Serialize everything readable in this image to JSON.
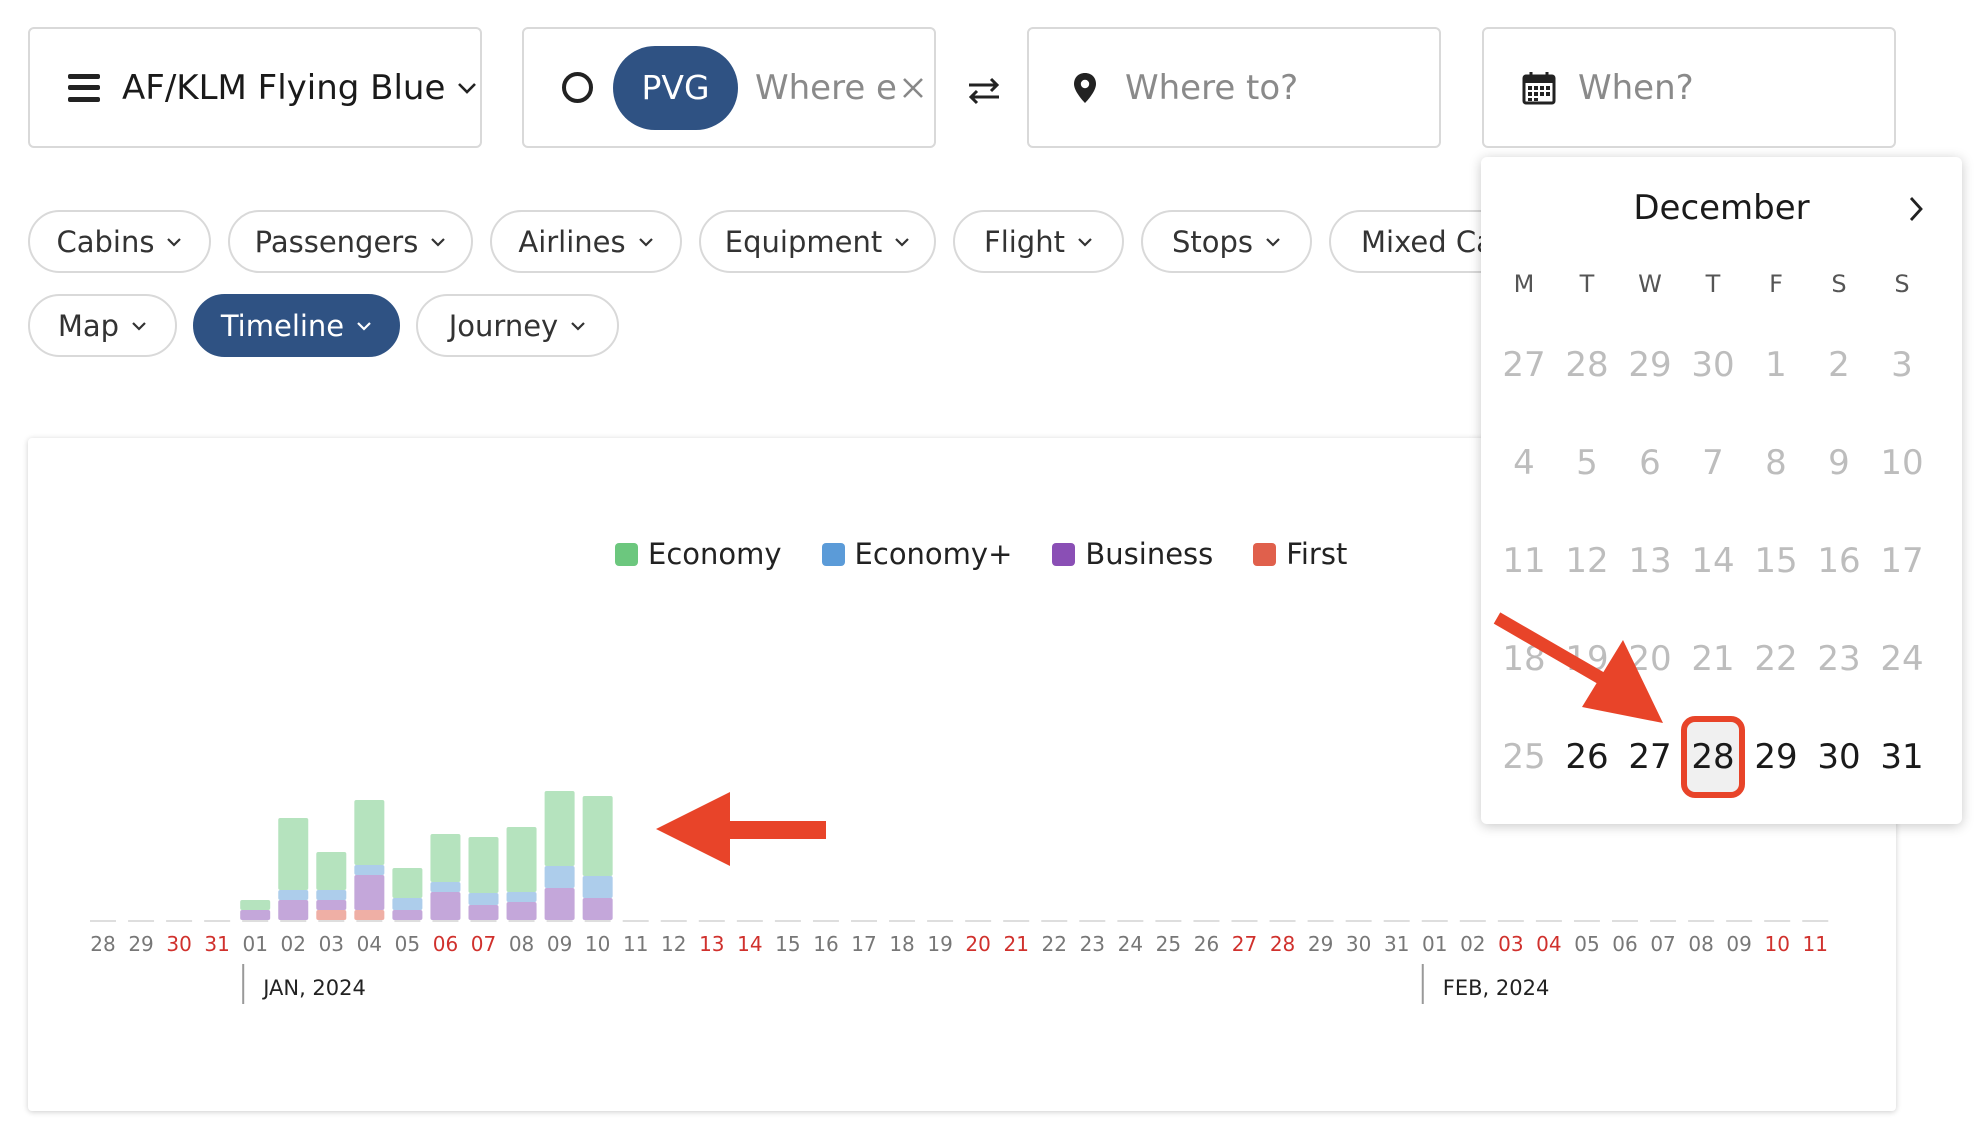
{
  "toolbar": {
    "program": "AF/KLM Flying Blue",
    "origin": "PVG",
    "origin_placeholder": "Where e",
    "destination_placeholder": "Where to?",
    "when_placeholder": "When?"
  },
  "filters": [
    "Cabins",
    "Passengers",
    "Airlines",
    "Equipment",
    "Flight",
    "Stops",
    "Mixed Cal"
  ],
  "views": [
    {
      "label": "Map",
      "active": false
    },
    {
      "label": "Timeline",
      "active": true
    },
    {
      "label": "Journey",
      "active": false
    }
  ],
  "calendar": {
    "month": "December",
    "weekdays": [
      "M",
      "T",
      "W",
      "T",
      "F",
      "S",
      "S"
    ],
    "weeks": [
      [
        "27",
        "28",
        "29",
        "30",
        "1",
        "2",
        "3"
      ],
      [
        "4",
        "5",
        "6",
        "7",
        "8",
        "9",
        "10"
      ],
      [
        "11",
        "12",
        "13",
        "14",
        "15",
        "16",
        "17"
      ],
      [
        "18",
        "19",
        "20",
        "21",
        "22",
        "23",
        "24"
      ],
      [
        "25",
        "26",
        "27",
        "28",
        "29",
        "30",
        "31"
      ]
    ],
    "selectable_days": [
      "26",
      "27",
      "28",
      "29",
      "30",
      "31"
    ],
    "highlighted_day": "28"
  },
  "legend": [
    {
      "name": "Economy",
      "color": "#6cc77e"
    },
    {
      "name": "Economy+",
      "color": "#5b9bd8"
    },
    {
      "name": "Business",
      "color": "#8a4fb5"
    },
    {
      "name": "First",
      "color": "#e0604c"
    }
  ],
  "chart_data": {
    "type": "bar",
    "stacked": true,
    "categories": [
      "28",
      "29",
      "30",
      "31",
      "01",
      "02",
      "03",
      "04",
      "05",
      "06",
      "07",
      "08",
      "09",
      "10",
      "11",
      "12",
      "13",
      "14",
      "15",
      "16",
      "17",
      "18",
      "19",
      "20",
      "21",
      "22",
      "23",
      "24",
      "25",
      "26",
      "27",
      "28",
      "29",
      "30",
      "31",
      "01",
      "02",
      "03",
      "04",
      "05",
      "06",
      "07",
      "08",
      "09",
      "10",
      "11"
    ],
    "weekend_labels": [
      2,
      3,
      9,
      10,
      16,
      17,
      23,
      24,
      30,
      31,
      37,
      38,
      44,
      45
    ],
    "months": [
      {
        "label": "JAN, 2024",
        "start_index": 4
      },
      {
        "label": "FEB, 2024",
        "start_index": 35
      }
    ],
    "series": [
      {
        "name": "First",
        "values": [
          0,
          0,
          0,
          0,
          0,
          0,
          10,
          10,
          0,
          0,
          0,
          0,
          0,
          0
        ]
      },
      {
        "name": "Business",
        "values": [
          0,
          0,
          0,
          0,
          10,
          20,
          10,
          35,
          10,
          28,
          15,
          18,
          32,
          22
        ]
      },
      {
        "name": "Economy+",
        "values": [
          0,
          0,
          0,
          0,
          0,
          10,
          10,
          10,
          12,
          10,
          12,
          10,
          22,
          22
        ]
      },
      {
        "name": "Economy",
        "values": [
          0,
          0,
          0,
          0,
          10,
          72,
          38,
          65,
          30,
          48,
          56,
          65,
          75,
          80
        ]
      }
    ],
    "ylim": [
      0,
      140
    ]
  }
}
